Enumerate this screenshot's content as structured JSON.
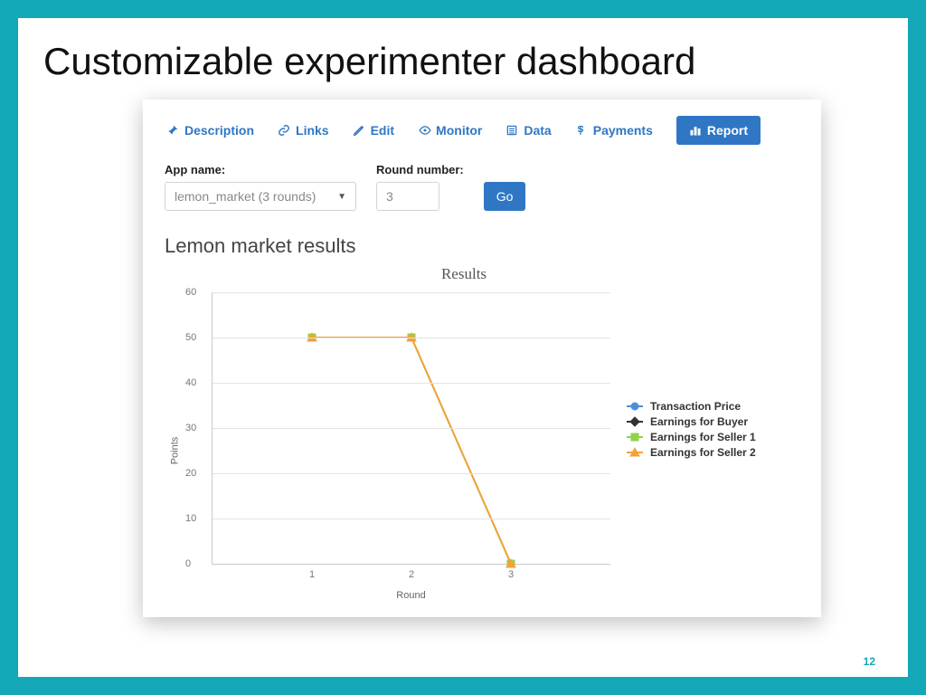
{
  "slide": {
    "title": "Customizable experimenter dashboard",
    "page_number": "12"
  },
  "tabs": {
    "description": "Description",
    "links": "Links",
    "edit": "Edit",
    "monitor": "Monitor",
    "data": "Data",
    "payments": "Payments",
    "report": "Report"
  },
  "form": {
    "app_label": "App name:",
    "app_value": "lemon_market (3 rounds)",
    "round_label": "Round number:",
    "round_value": "3",
    "go_label": "Go"
  },
  "results_heading": "Lemon market results",
  "chart_data": {
    "type": "line",
    "title": "Results",
    "xlabel": "Round",
    "ylabel": "Points",
    "categories": [
      "1",
      "2",
      "3"
    ],
    "yticks": [
      0,
      10,
      20,
      30,
      40,
      50,
      60
    ],
    "ylim": [
      0,
      60
    ],
    "series": [
      {
        "name": "Transaction Price",
        "color": "#4a90d9",
        "marker": "circle",
        "values": [
          null,
          null,
          null
        ]
      },
      {
        "name": "Earnings for Buyer",
        "color": "#333333",
        "marker": "diamond",
        "values": [
          null,
          null,
          null
        ]
      },
      {
        "name": "Earnings for Seller 1",
        "color": "#8fd24a",
        "marker": "square",
        "values": [
          50,
          50,
          0
        ]
      },
      {
        "name": "Earnings for Seller 2",
        "color": "#f2a23a",
        "marker": "triangle",
        "values": [
          50,
          50,
          0
        ]
      }
    ]
  },
  "legend": {
    "items": [
      {
        "label": "Transaction Price",
        "color": "#4a90d9",
        "marker": "circle"
      },
      {
        "label": "Earnings for Buyer",
        "color": "#333333",
        "marker": "diamond"
      },
      {
        "label": "Earnings for Seller 1",
        "color": "#8fd24a",
        "marker": "square"
      },
      {
        "label": "Earnings for Seller 2",
        "color": "#f2a23a",
        "marker": "triangle"
      }
    ]
  }
}
